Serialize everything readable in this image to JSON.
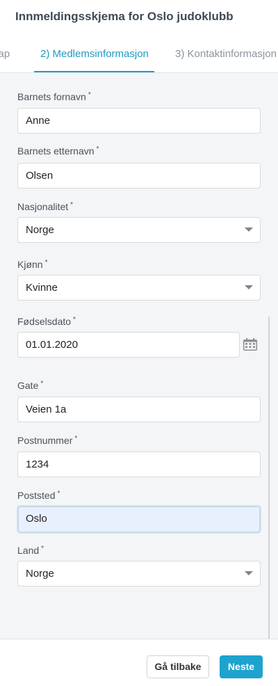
{
  "header": {
    "title": "Innmeldingsskjema for Oslo judoklubb"
  },
  "tabs": [
    {
      "label": "kap"
    },
    {
      "label": "2) Medlemsinformasjon"
    },
    {
      "label": "3) Kontaktinformasjon"
    }
  ],
  "form": {
    "required_marker": "*",
    "first_name": {
      "label": "Barnets fornavn",
      "value": "Anne"
    },
    "last_name": {
      "label": "Barnets etternavn",
      "value": "Olsen"
    },
    "nationality": {
      "label": "Nasjonalitet",
      "value": "Norge"
    },
    "gender": {
      "label": "Kjønn",
      "value": "Kvinne"
    },
    "birthdate": {
      "label": "Fødselsdato",
      "value": "01.01.2020"
    },
    "street": {
      "label": "Gate",
      "value": "Veien 1a"
    },
    "postal_code": {
      "label": "Postnummer",
      "value": "1234"
    },
    "city": {
      "label": "Poststed",
      "value": "Oslo"
    },
    "country": {
      "label": "Land",
      "value": "Norge"
    }
  },
  "footer": {
    "back_label": "Gå tilbake",
    "next_label": "Neste"
  },
  "colors": {
    "accent": "#1e9bc1",
    "primary_button": "#1ea3cf",
    "focused_field": "#e8f0fe"
  },
  "icons": {
    "date_picker": "calendar-icon",
    "select": "chevron-down-icon"
  }
}
